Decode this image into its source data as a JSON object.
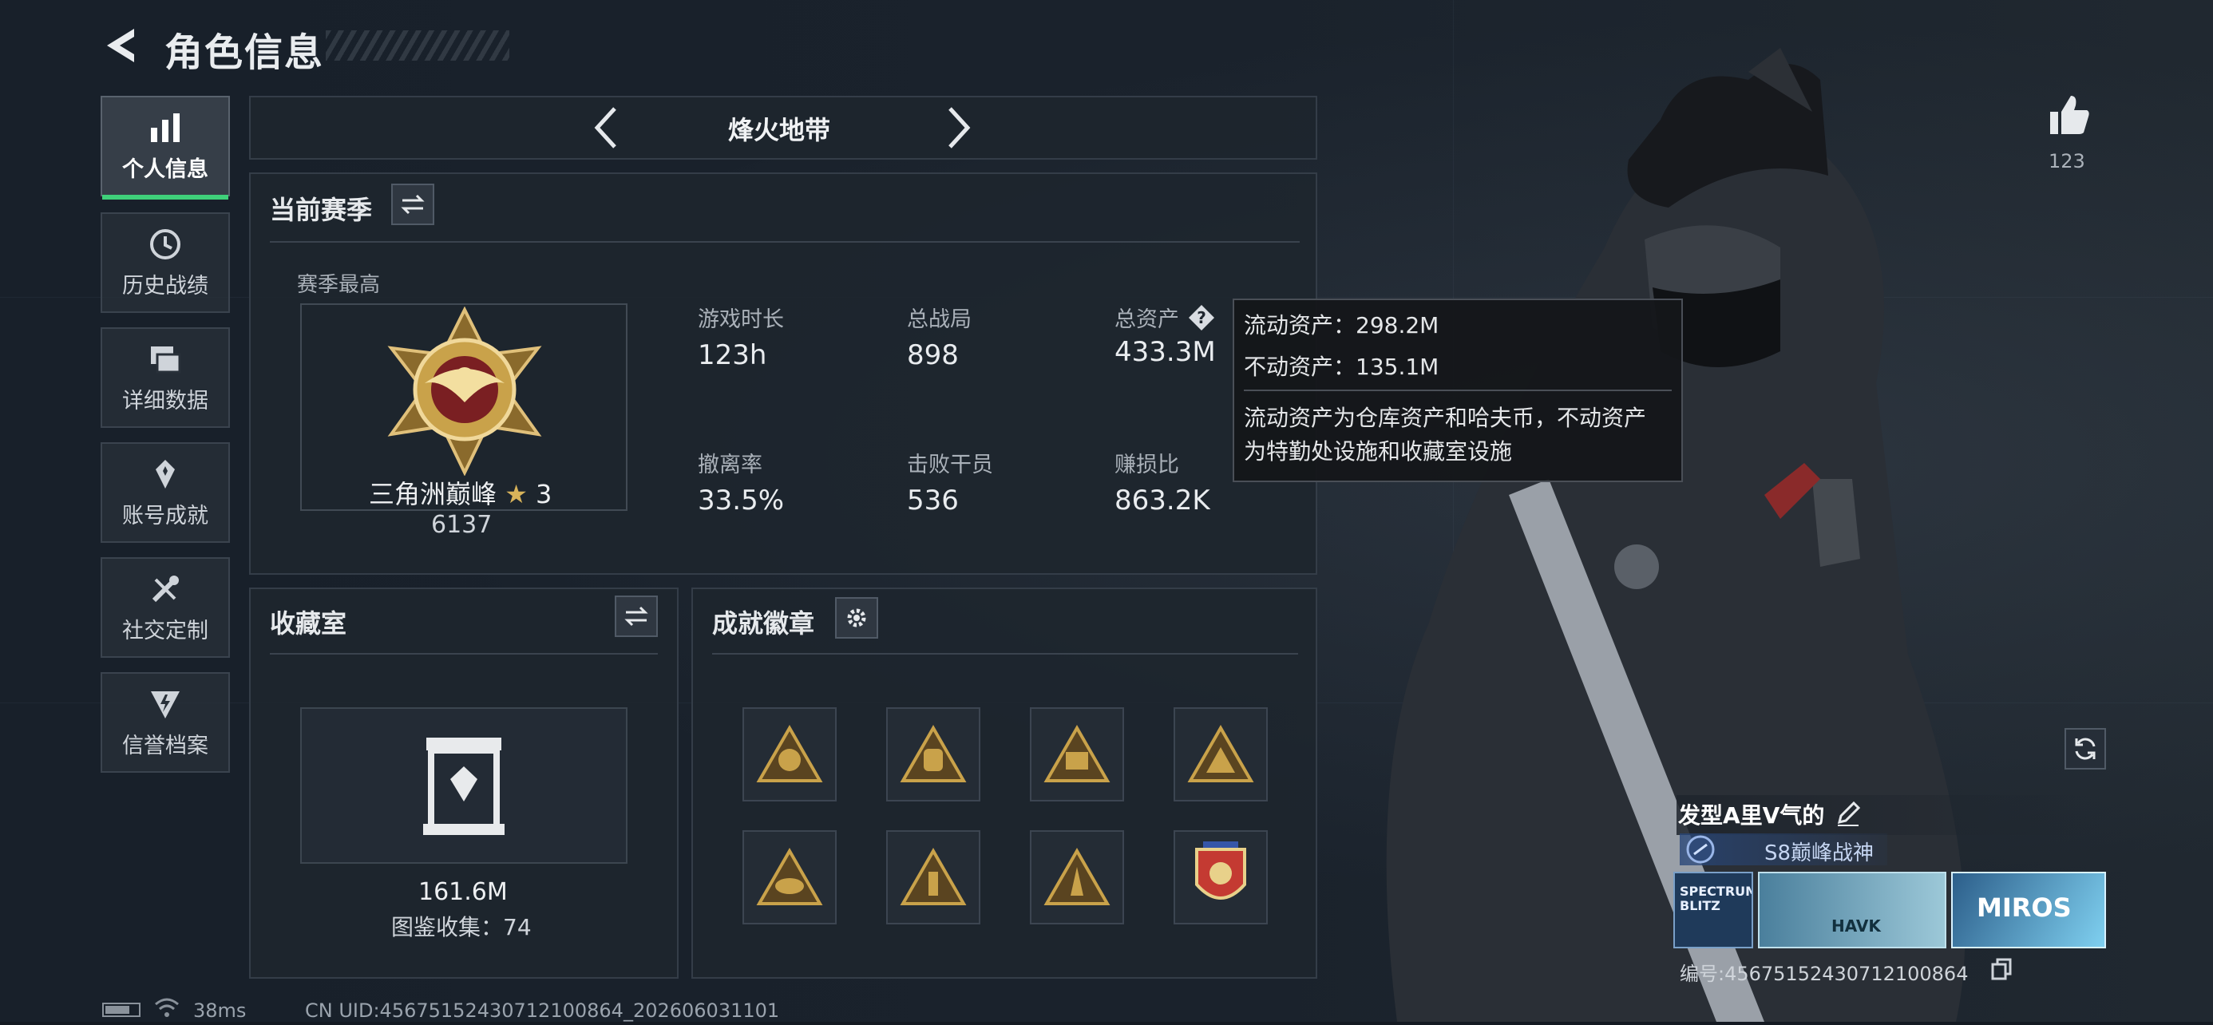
{
  "header": {
    "title": "角色信息"
  },
  "sidebar": {
    "items": [
      {
        "label": "个人信息",
        "active": true,
        "icon": "bar-chart-icon"
      },
      {
        "label": "历史战绩",
        "active": false,
        "icon": "history-clock-icon"
      },
      {
        "label": "详细数据",
        "active": false,
        "icon": "folders-icon"
      },
      {
        "label": "账号成就",
        "active": false,
        "icon": "achievement-icon"
      },
      {
        "label": "社交定制",
        "active": false,
        "icon": "tools-icon"
      },
      {
        "label": "信誉档案",
        "active": false,
        "icon": "credit-shield-icon"
      }
    ]
  },
  "mode_selector": {
    "label": "烽火地带"
  },
  "season": {
    "title": "当前赛季",
    "best_label": "赛季最高",
    "rank_name": "三角洲巅峰",
    "rank_stars": "3",
    "rank_score": "6137",
    "stats": [
      {
        "label": "游戏时长",
        "value": "123h"
      },
      {
        "label": "总战局",
        "value": "898"
      },
      {
        "label": "总资产",
        "value": "433.3M"
      },
      {
        "label": "撤离率",
        "value": "33.5%"
      },
      {
        "label": "击败干员",
        "value": "536"
      },
      {
        "label": "赚损比",
        "value": "863.2K"
      }
    ]
  },
  "tooltip": {
    "liquid": "流动资产：298.2M",
    "fixed": "不动资产：135.1M",
    "desc_line1": "流动资产为仓库资产和哈夫币，不动资产",
    "desc_line2": "为特勤处设施和收藏室设施"
  },
  "collection": {
    "title": "收藏室",
    "value": "161.6M",
    "catalog": "图鉴收集：74"
  },
  "achievements": {
    "title": "成就徽章",
    "badges": [
      "badge-1",
      "badge-2",
      "badge-3",
      "badge-4",
      "badge-5",
      "badge-6",
      "badge-7",
      "badge-8"
    ]
  },
  "profile": {
    "likes": "123",
    "player_name": "发型A里V气的",
    "title_badge": "S8巅峰战神",
    "card1_text": "SPECTRUM BLITZ",
    "card2_text": "HAVK",
    "card3_text": "MIROS",
    "serial": "编号:45675152430712100864"
  },
  "status_bar": {
    "ping": "38ms",
    "uid": "CN UID:45675152430712100864_202606031101"
  },
  "colors": {
    "accent_green": "#3fd07a",
    "gold": "#c9a24a",
    "panel": "#1e252e"
  }
}
